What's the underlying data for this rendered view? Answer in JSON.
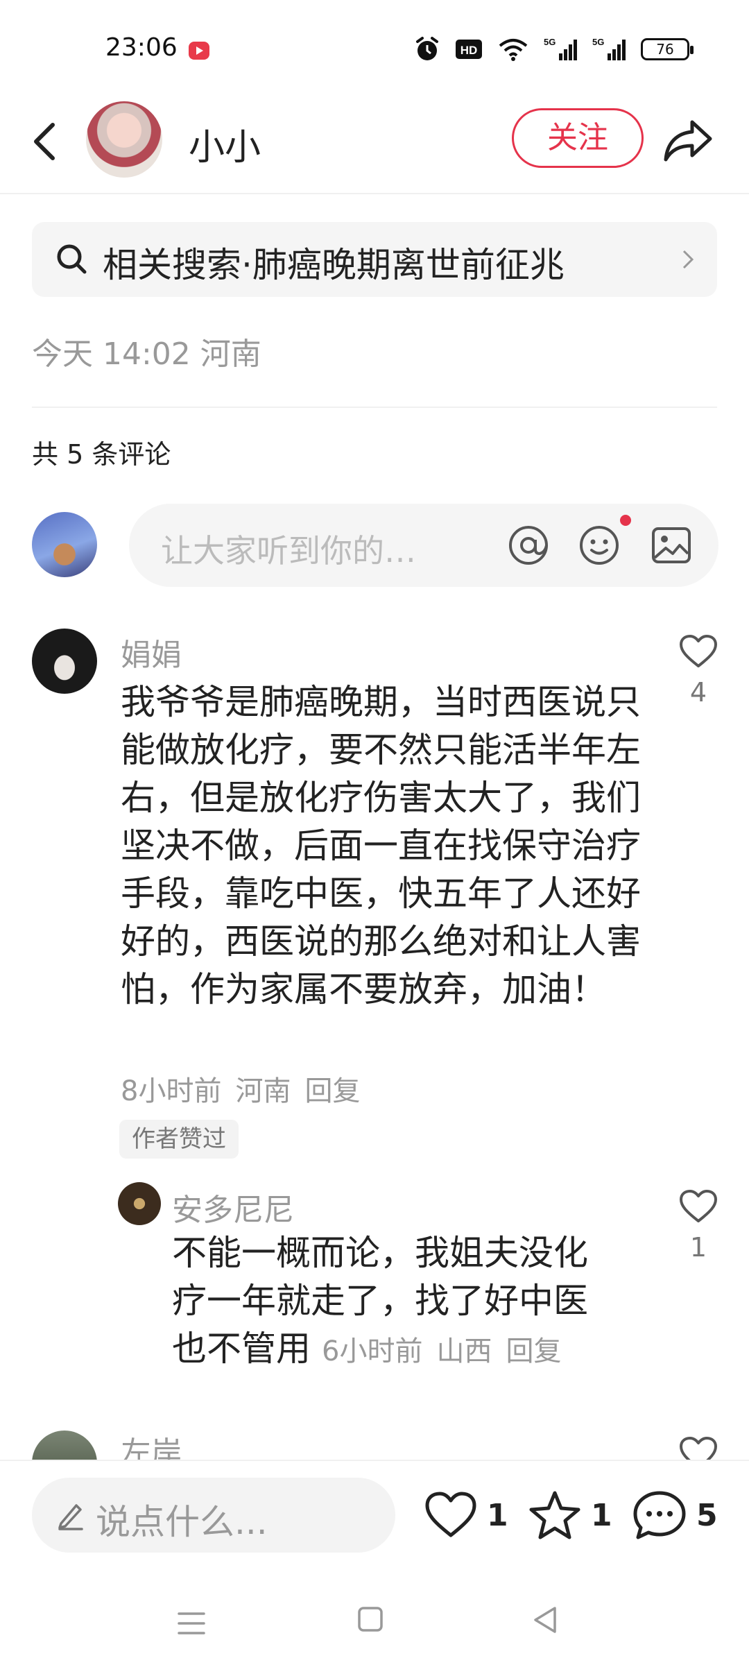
{
  "status_bar": {
    "time": "23:06",
    "icons": [
      "alarm-icon",
      "hd-icon",
      "wifi-icon",
      "signal-5g-icon",
      "signal-5g-icon"
    ],
    "battery": "76"
  },
  "header": {
    "name": "小小",
    "follow_label": "关注"
  },
  "related_search": {
    "text": "相关搜索·肺癌晚期离世前征兆"
  },
  "post_meta": {
    "time_location": "今天 14:02 河南"
  },
  "comments_section": {
    "count_label": "共 5 条评论",
    "input_placeholder": "让大家听到你的…"
  },
  "comments": [
    {
      "name": "娟娟",
      "text": "我爷爷是肺癌晚期，当时西医说只能做放化疗，要不然只能活半年左右，但是放化疗伤害太大了，我们坚决不做，后面一直在找保守治疗手段，靠吃中医，快五年了人还好好的，西医说的那么绝对和让人害怕，作为家属不要放弃，加油！",
      "time": "8小时前",
      "location": "河南",
      "reply_label": "回复",
      "badge": "作者赞过",
      "likes": "4"
    },
    {
      "name": "安多尼尼",
      "text": "不能一概而论，我姐夫没化疗一年就走了，找了好中医也不管用",
      "time": "6小时前",
      "location": "山西",
      "reply_label": "回复",
      "likes": "1"
    },
    {
      "name": "左岸"
    }
  ],
  "bottom_bar": {
    "say_placeholder": "说点什么...",
    "like_count": "1",
    "collect_count": "1",
    "comment_count": "5"
  },
  "colors": {
    "accent": "#e5334b",
    "muted_text": "#999999",
    "background": "#ffffff"
  }
}
